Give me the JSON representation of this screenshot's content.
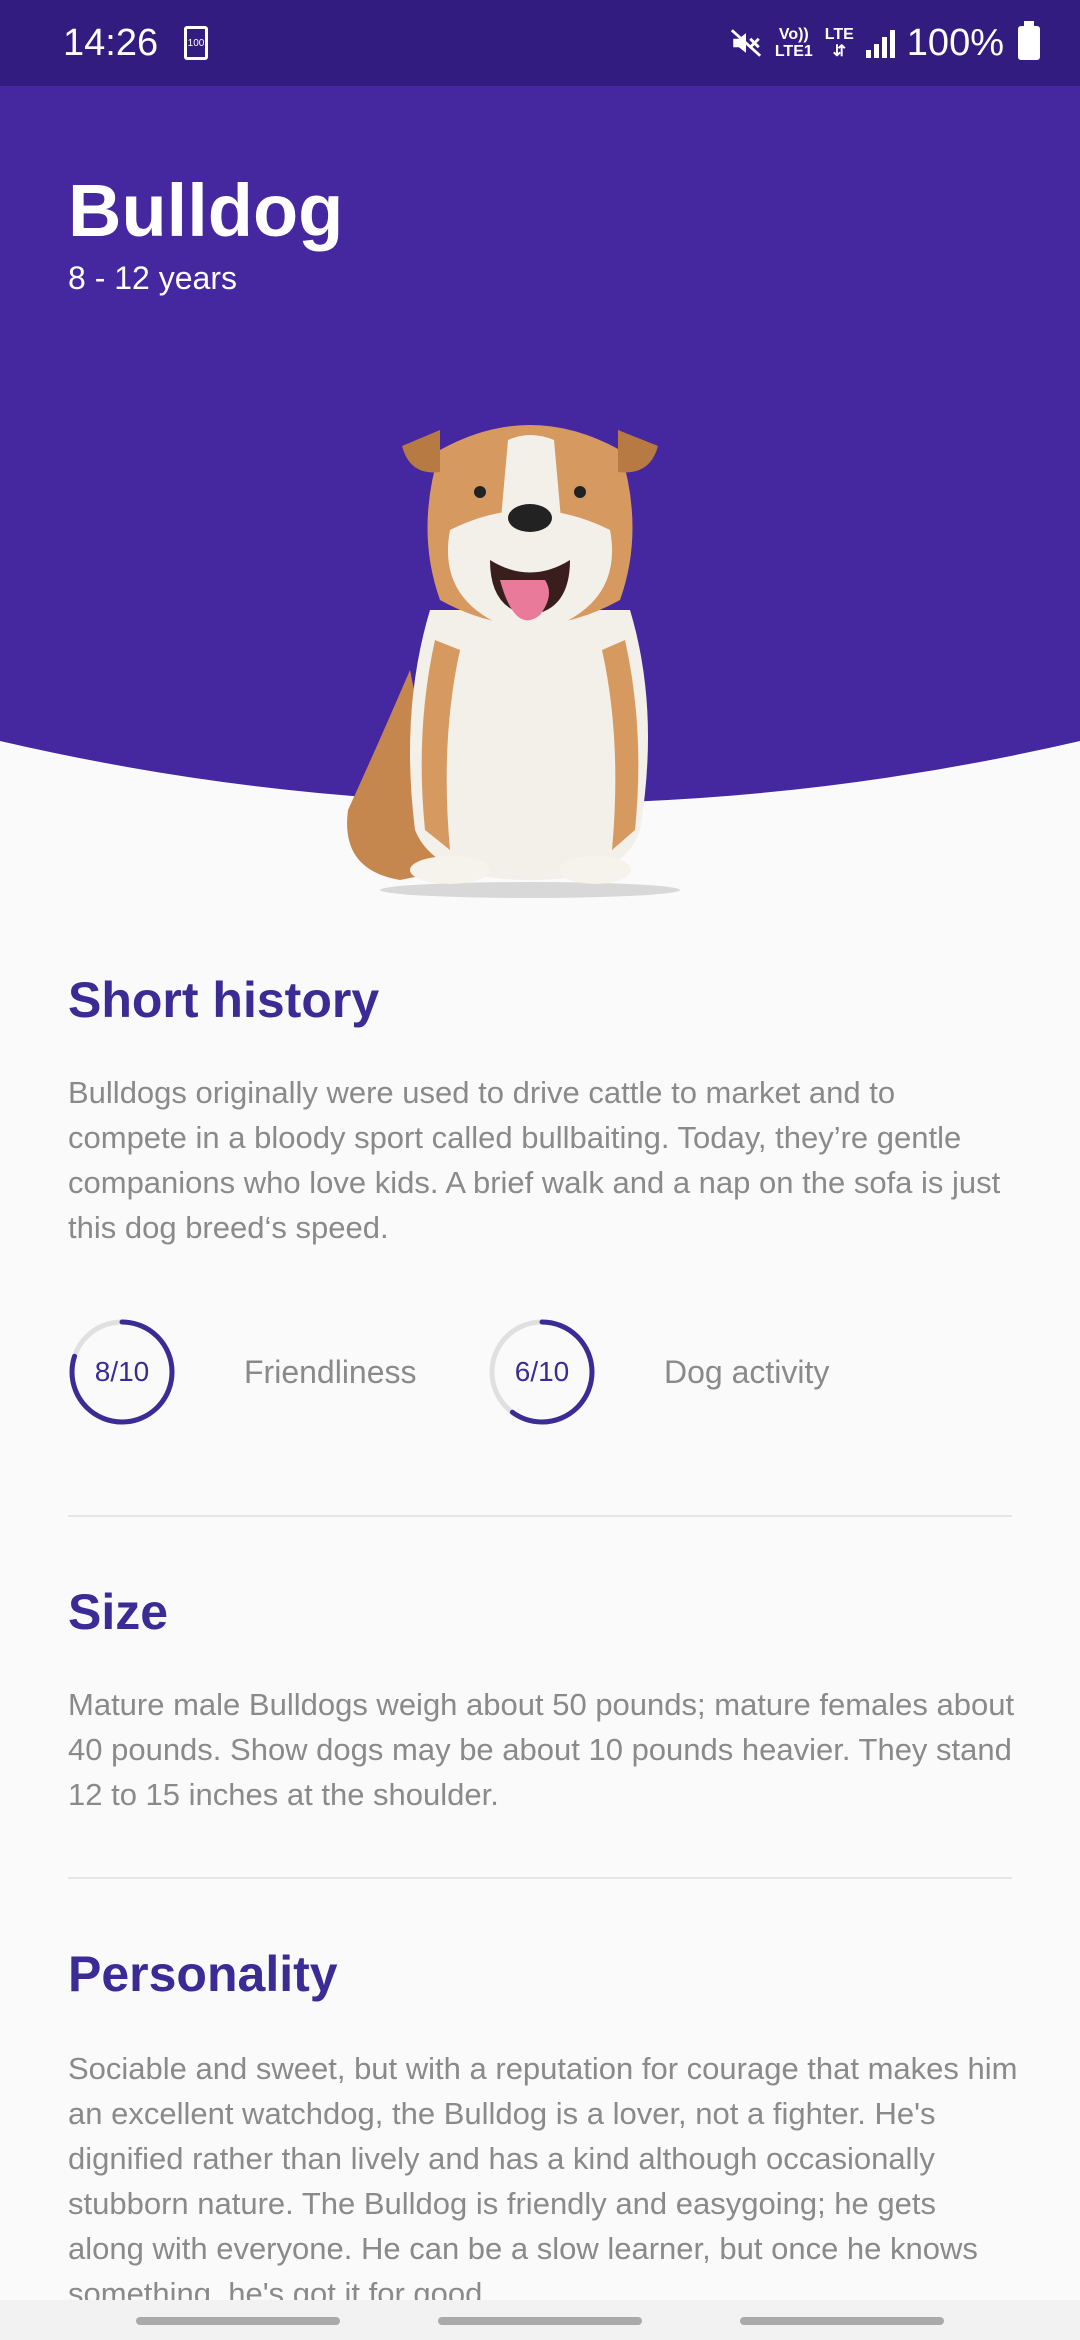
{
  "status_bar": {
    "time": "14:26",
    "battery_saver_text": "100",
    "network_volte": "Vo))",
    "network_lte1": "LTE1",
    "network_lte": "LTE",
    "battery_percent": "100%"
  },
  "header": {
    "title": "Bulldog",
    "lifespan": "8 - 12 years",
    "background_color": "#4527a0"
  },
  "sections": {
    "history": {
      "title": "Short history",
      "text": "Bulldogs originally were used to drive cattle to market and to compete in a bloody sport called bullbaiting. Today, they’re gentle companions who love kids. A brief walk and a nap on the sofa is just this dog breed‘s speed."
    },
    "size": {
      "title": "Size",
      "text": "Mature male Bulldogs weigh about 50 pounds; mature females about 40 pounds. Show dogs may be about 10 pounds heavier. They stand 12 to 15 inches at the shoulder."
    },
    "personality": {
      "title": "Personality",
      "text": "Sociable and sweet, but with a reputation for courage that makes him an excellent watchdog, the Bulldog is a lover, not a fighter. He's dignified rather than lively and has a kind although occasionally stubborn nature. The Bulldog is friendly and easygoing; he gets along with everyone. He can be a slow learner, but once he knows something, he's got it for good."
    }
  },
  "ratings": {
    "friendliness": {
      "value_text": "8/10",
      "label": "Friendliness",
      "score": 8,
      "max": 10
    },
    "activity": {
      "value_text": "6/10",
      "label": "Dog activity",
      "score": 6,
      "max": 10
    }
  },
  "colors": {
    "accent": "#3b2b95",
    "status_bar": "#321c80",
    "ring_track": "#e0e0e0"
  }
}
